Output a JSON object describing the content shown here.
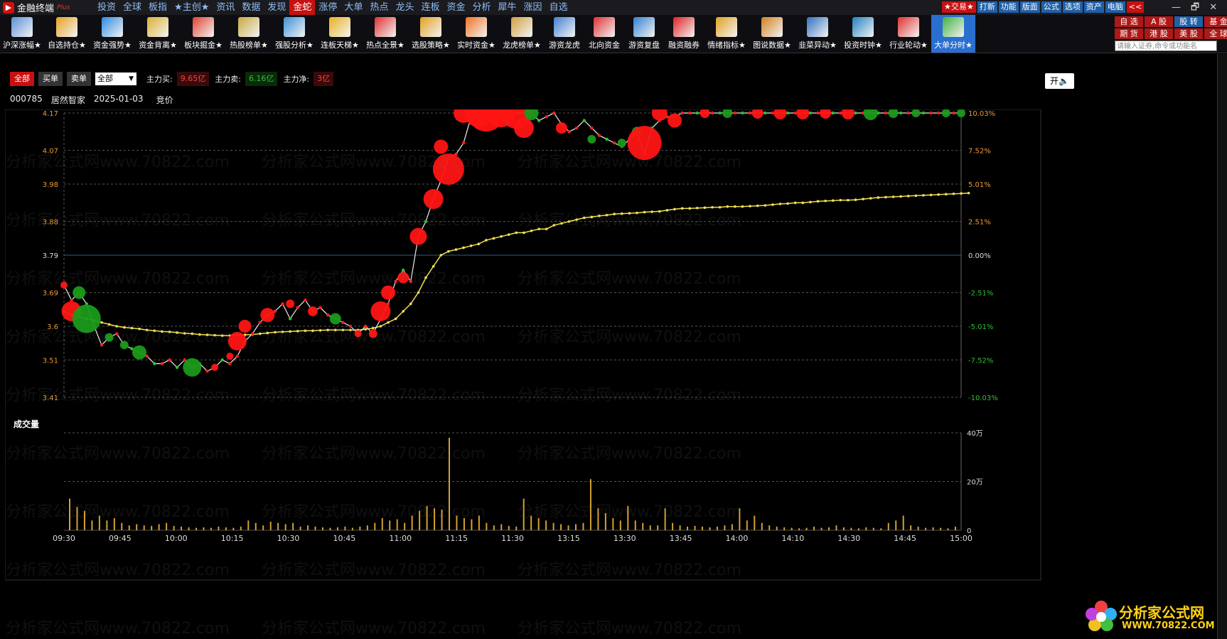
{
  "app": {
    "name": "金融终端",
    "edition": "Plus"
  },
  "menu": [
    "投资",
    "全球",
    "板指",
    "★主创★",
    "资讯",
    "数据",
    "发现",
    "金蛇",
    "涨停",
    "大单",
    "热点",
    "龙头",
    "连板",
    "资金",
    "分析",
    "犀牛",
    "涨因",
    "自选"
  ],
  "menu_active": "金蛇",
  "right_buttons": [
    {
      "label": "★交易★",
      "hot": true
    },
    {
      "label": "打新",
      "hot": false
    },
    {
      "label": "功能",
      "hot": false
    },
    {
      "label": "版面",
      "hot": false
    },
    {
      "label": "公式",
      "hot": false
    },
    {
      "label": "选项",
      "hot": false
    },
    {
      "label": "资产",
      "hot": false
    },
    {
      "label": "电脑",
      "hot": false
    },
    {
      "label": "<<",
      "hot": true
    }
  ],
  "window_controls": [
    "—",
    "🗗",
    "✕"
  ],
  "toolbar": [
    {
      "label": "沪深涨幅★",
      "color": "#5a8fd8"
    },
    {
      "label": "自选持仓★",
      "color": "#e8a020"
    },
    {
      "label": "资金强势★",
      "color": "#2a8ae0"
    },
    {
      "label": "资金背离★",
      "color": "#d8b030"
    },
    {
      "label": "板块掘金★",
      "color": "#e04030"
    },
    {
      "label": "热股榜单★",
      "color": "#c8a840"
    },
    {
      "label": "强股分析★",
      "color": "#3a90d8"
    },
    {
      "label": "连板天梯★",
      "color": "#e8b020"
    },
    {
      "label": "热点全景★",
      "color": "#e03030"
    },
    {
      "label": "选股策略★",
      "color": "#e0a020"
    },
    {
      "label": "实时资金★",
      "color": "#f07020"
    },
    {
      "label": "龙虎榜单★",
      "color": "#d0a040"
    },
    {
      "label": "游资龙虎",
      "color": "#4080d0"
    },
    {
      "label": "北向资金",
      "color": "#e03030"
    },
    {
      "label": "游资复盘",
      "color": "#3080d0"
    },
    {
      "label": "融资融券",
      "color": "#e02020"
    },
    {
      "label": "情绪指标★",
      "color": "#e0a020"
    },
    {
      "label": "图说数据★",
      "color": "#d08020"
    },
    {
      "label": "韭菜异动★",
      "color": "#3070c0"
    },
    {
      "label": "投资时钟★",
      "color": "#2080c0"
    },
    {
      "label": "行业轮动★",
      "color": "#e03030"
    },
    {
      "label": "大单分时★",
      "color": "#40b040"
    }
  ],
  "toolbar_selected": "大单分时★",
  "quick_grid": [
    {
      "label": "自 选",
      "blue": false
    },
    {
      "label": "A 股",
      "blue": false
    },
    {
      "label": "股 转",
      "blue": true
    },
    {
      "label": "基 金",
      "blue": false
    },
    {
      "label": "期 货",
      "blue": false
    },
    {
      "label": "港 股",
      "blue": false
    },
    {
      "label": "美 股",
      "blue": false
    },
    {
      "label": "全 球",
      "blue": false
    }
  ],
  "search": {
    "placeholder": "请输入证券,命令或功能名"
  },
  "filter": {
    "buttons": [
      "全部",
      "买单",
      "卖单"
    ],
    "active": "全部",
    "select_value": "全部",
    "main_buy_label": "主力买:",
    "main_buy": "9.65亿",
    "main_sell_label": "主力卖:",
    "main_sell": "6.16亿",
    "main_net_label": "主力净:",
    "main_net": "3亿"
  },
  "toggle_label": "开🔈",
  "stock": {
    "code": "000785",
    "name": "居然智家",
    "date": "2025-01-03",
    "mode": "竞价"
  },
  "watermark_text": "分析家公式网www.70822.com",
  "brand": {
    "name": "分析家公式网",
    "url": "WWW.70822.COM"
  },
  "chart_data": {
    "type": "line",
    "price_axis": {
      "ticks": [
        4.17,
        4.07,
        3.98,
        3.88,
        3.79,
        3.69,
        3.6,
        3.51,
        3.41
      ],
      "range": [
        3.41,
        4.17
      ],
      "base": 3.79
    },
    "pct_axis": {
      "ticks": [
        "10.03%",
        "7.52%",
        "5.01%",
        "2.51%",
        "0.00%",
        "-2.51%",
        "-5.01%",
        "-7.52%",
        "-10.03%"
      ]
    },
    "x_ticks": [
      "09:30",
      "09:45",
      "10:00",
      "10:15",
      "10:30",
      "10:45",
      "11:00",
      "11:15",
      "11:30",
      "13:15",
      "13:30",
      "13:45",
      "14:00",
      "14:10",
      "14:30",
      "14:45",
      "15:00"
    ],
    "volume_title": "成交量",
    "volume_ticks": [
      "40万",
      "20万",
      "0"
    ],
    "volume_max": 400000,
    "price": [
      3.71,
      3.67,
      3.69,
      3.66,
      3.6,
      3.55,
      3.57,
      3.58,
      3.55,
      3.54,
      3.53,
      3.52,
      3.5,
      3.5,
      3.51,
      3.49,
      3.51,
      3.49,
      3.5,
      3.48,
      3.49,
      3.51,
      3.5,
      3.52,
      3.56,
      3.58,
      3.61,
      3.63,
      3.64,
      3.66,
      3.62,
      3.65,
      3.67,
      3.64,
      3.65,
      3.63,
      3.62,
      3.61,
      3.6,
      3.58,
      3.6,
      3.58,
      3.62,
      3.66,
      3.72,
      3.75,
      3.72,
      3.84,
      3.88,
      3.94,
      3.99,
      4.05,
      4.06,
      4.09,
      4.16,
      4.17,
      4.17,
      4.17,
      4.17,
      4.17,
      4.17,
      4.17,
      4.17,
      4.15,
      4.16,
      4.17,
      4.14,
      4.12,
      4.13,
      4.15,
      4.13,
      4.11,
      4.1,
      4.09,
      4.08,
      4.1,
      4.12,
      4.06,
      4.13,
      4.15,
      4.16,
      4.16,
      4.17,
      4.17,
      4.17,
      4.17,
      4.17,
      4.17,
      4.17,
      4.17,
      4.17,
      4.17,
      4.17,
      4.17,
      4.17,
      4.17,
      4.17,
      4.17,
      4.17,
      4.17,
      4.17,
      4.17,
      4.17,
      4.17,
      4.17,
      4.17,
      4.17,
      4.17,
      4.17,
      4.17,
      4.17,
      4.17,
      4.17,
      4.17,
      4.17,
      4.17,
      4.17,
      4.17,
      4.17,
      4.17
    ],
    "avg": [
      3.64,
      3.63,
      3.625,
      3.62,
      3.615,
      3.61,
      3.605,
      3.6,
      3.597,
      3.595,
      3.593,
      3.59,
      3.588,
      3.586,
      3.585,
      3.583,
      3.581,
      3.58,
      3.578,
      3.577,
      3.576,
      3.575,
      3.575,
      3.576,
      3.577,
      3.578,
      3.58,
      3.582,
      3.584,
      3.585,
      3.586,
      3.587,
      3.588,
      3.588,
      3.589,
      3.59,
      3.59,
      3.59,
      3.59,
      3.59,
      3.592,
      3.595,
      3.6,
      3.61,
      3.62,
      3.64,
      3.66,
      3.69,
      3.73,
      3.76,
      3.79,
      3.8,
      3.805,
      3.81,
      3.815,
      3.82,
      3.83,
      3.835,
      3.84,
      3.845,
      3.85,
      3.85,
      3.855,
      3.86,
      3.86,
      3.87,
      3.875,
      3.88,
      3.885,
      3.89,
      3.892,
      3.895,
      3.897,
      3.9,
      3.901,
      3.902,
      3.903,
      3.905,
      3.906,
      3.907,
      3.91,
      3.913,
      3.915,
      3.915,
      3.916,
      3.917,
      3.918,
      3.918,
      3.92,
      3.92,
      3.92,
      3.921,
      3.922,
      3.923,
      3.925,
      3.927,
      3.928,
      3.93,
      3.93,
      3.932,
      3.934,
      3.935,
      3.936,
      3.937,
      3.937,
      3.938,
      3.94,
      3.942,
      3.944,
      3.945,
      3.946,
      3.947,
      3.948,
      3.949,
      3.95,
      3.951,
      3.952,
      3.953,
      3.954,
      3.955,
      3.956
    ],
    "bubbles": [
      {
        "i": 0,
        "v": 3.71,
        "r": 5,
        "side": "buy"
      },
      {
        "i": 1,
        "v": 3.64,
        "r": 14,
        "side": "buy"
      },
      {
        "i": 2,
        "v": 3.69,
        "r": 9,
        "side": "sell"
      },
      {
        "i": 3,
        "v": 3.62,
        "r": 20,
        "side": "sell"
      },
      {
        "i": 6,
        "v": 3.57,
        "r": 6,
        "side": "sell"
      },
      {
        "i": 8,
        "v": 3.55,
        "r": 6,
        "side": "sell"
      },
      {
        "i": 10,
        "v": 3.53,
        "r": 10,
        "side": "sell"
      },
      {
        "i": 17,
        "v": 3.49,
        "r": 13,
        "side": "sell"
      },
      {
        "i": 20,
        "v": 3.49,
        "r": 5,
        "side": "buy"
      },
      {
        "i": 22,
        "v": 3.52,
        "r": 5,
        "side": "buy"
      },
      {
        "i": 23,
        "v": 3.56,
        "r": 13,
        "side": "buy"
      },
      {
        "i": 24,
        "v": 3.6,
        "r": 9,
        "side": "buy"
      },
      {
        "i": 27,
        "v": 3.63,
        "r": 10,
        "side": "buy"
      },
      {
        "i": 30,
        "v": 3.66,
        "r": 6,
        "side": "buy"
      },
      {
        "i": 33,
        "v": 3.64,
        "r": 7,
        "side": "buy"
      },
      {
        "i": 36,
        "v": 3.62,
        "r": 8,
        "side": "sell"
      },
      {
        "i": 39,
        "v": 3.58,
        "r": 5,
        "side": "buy"
      },
      {
        "i": 41,
        "v": 3.58,
        "r": 6,
        "side": "buy"
      },
      {
        "i": 42,
        "v": 3.64,
        "r": 14,
        "side": "buy"
      },
      {
        "i": 43,
        "v": 3.69,
        "r": 10,
        "side": "buy"
      },
      {
        "i": 45,
        "v": 3.73,
        "r": 8,
        "side": "buy"
      },
      {
        "i": 47,
        "v": 3.84,
        "r": 12,
        "side": "buy"
      },
      {
        "i": 49,
        "v": 3.94,
        "r": 14,
        "side": "buy"
      },
      {
        "i": 51,
        "v": 4.02,
        "r": 22,
        "side": "buy"
      },
      {
        "i": 50,
        "v": 4.08,
        "r": 10,
        "side": "buy"
      },
      {
        "i": 53,
        "v": 4.17,
        "r": 14,
        "side": "buy"
      },
      {
        "i": 55,
        "v": 4.17,
        "r": 20,
        "side": "buy"
      },
      {
        "i": 56,
        "v": 4.17,
        "r": 26,
        "side": "buy"
      },
      {
        "i": 58,
        "v": 4.17,
        "r": 20,
        "side": "buy"
      },
      {
        "i": 60,
        "v": 4.17,
        "r": 22,
        "side": "buy"
      },
      {
        "i": 61,
        "v": 4.13,
        "r": 14,
        "side": "buy"
      },
      {
        "i": 62,
        "v": 4.17,
        "r": 10,
        "side": "sell"
      },
      {
        "i": 66,
        "v": 4.13,
        "r": 8,
        "side": "buy"
      },
      {
        "i": 70,
        "v": 4.1,
        "r": 6,
        "side": "sell"
      },
      {
        "i": 74,
        "v": 4.09,
        "r": 6,
        "side": "sell"
      },
      {
        "i": 76,
        "v": 4.12,
        "r": 7,
        "side": "sell"
      },
      {
        "i": 77,
        "v": 4.09,
        "r": 24,
        "side": "buy"
      },
      {
        "i": 79,
        "v": 4.17,
        "r": 11,
        "side": "buy"
      },
      {
        "i": 81,
        "v": 4.15,
        "r": 10,
        "side": "buy"
      },
      {
        "i": 85,
        "v": 4.17,
        "r": 7,
        "side": "buy"
      },
      {
        "i": 88,
        "v": 4.17,
        "r": 7,
        "side": "sell"
      },
      {
        "i": 92,
        "v": 4.17,
        "r": 8,
        "side": "buy"
      },
      {
        "i": 95,
        "v": 4.17,
        "r": 9,
        "side": "buy"
      },
      {
        "i": 98,
        "v": 4.17,
        "r": 9,
        "side": "buy"
      },
      {
        "i": 101,
        "v": 4.17,
        "r": 8,
        "side": "buy"
      },
      {
        "i": 104,
        "v": 4.17,
        "r": 9,
        "side": "buy"
      },
      {
        "i": 107,
        "v": 4.17,
        "r": 10,
        "side": "sell"
      },
      {
        "i": 110,
        "v": 4.17,
        "r": 7,
        "side": "sell"
      },
      {
        "i": 113,
        "v": 4.17,
        "r": 6,
        "side": "sell"
      },
      {
        "i": 117,
        "v": 4.17,
        "r": 6,
        "side": "sell"
      },
      {
        "i": 119,
        "v": 4.17,
        "r": 6,
        "side": "sell"
      }
    ],
    "volume": [
      130000,
      95000,
      80000,
      40000,
      60000,
      40000,
      50000,
      30000,
      20000,
      25000,
      20000,
      18000,
      25000,
      30000,
      18000,
      15000,
      12000,
      10000,
      12000,
      10000,
      15000,
      12000,
      10000,
      15000,
      40000,
      30000,
      20000,
      35000,
      30000,
      25000,
      30000,
      15000,
      20000,
      15000,
      12000,
      10000,
      12000,
      15000,
      10000,
      15000,
      20000,
      30000,
      50000,
      40000,
      45000,
      30000,
      60000,
      80000,
      100000,
      90000,
      85000,
      380000,
      60000,
      50000,
      45000,
      60000,
      30000,
      20000,
      25000,
      18000,
      15000,
      130000,
      60000,
      50000,
      40000,
      30000,
      25000,
      20000,
      25000,
      30000,
      210000,
      90000,
      70000,
      50000,
      40000,
      100000,
      40000,
      30000,
      20000,
      20000,
      90000,
      30000,
      20000,
      15000,
      18000,
      15000,
      12000,
      15000,
      20000,
      25000,
      90000,
      40000,
      60000,
      30000,
      20000,
      15000,
      12000,
      10000,
      8000,
      10000,
      15000,
      10000,
      12000,
      20000,
      12000,
      10000,
      8000,
      12000,
      10000,
      8000,
      30000,
      40000,
      60000,
      20000,
      15000,
      10000,
      12000,
      10000,
      8000,
      15000
    ]
  }
}
